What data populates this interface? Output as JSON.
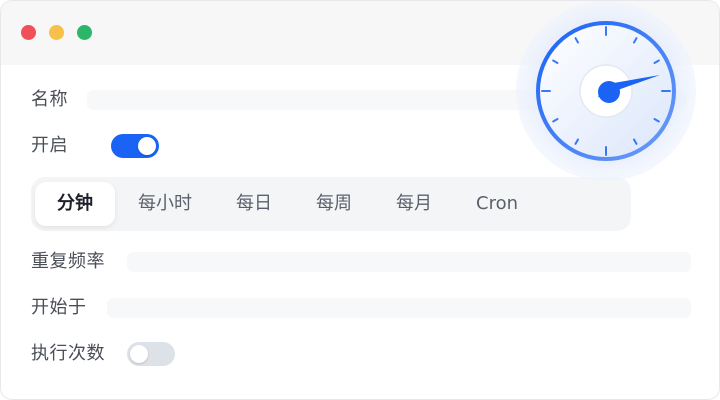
{
  "window": {
    "controls": [
      "close",
      "minimize",
      "maximize"
    ]
  },
  "form": {
    "name_label": "名称",
    "enable_label": "开启",
    "enable_on": true,
    "repeat_label": "重复频率",
    "start_label": "开始于",
    "exec_count_label": "执行次数",
    "exec_count_on": false
  },
  "tabs": {
    "items": [
      {
        "label": "分钟",
        "active": true
      },
      {
        "label": "每小时",
        "active": false
      },
      {
        "label": "每日",
        "active": false
      },
      {
        "label": "每周",
        "active": false
      },
      {
        "label": "每月",
        "active": false
      },
      {
        "label": "Cron",
        "active": false
      }
    ]
  },
  "gauge": {
    "icon": "speedometer-icon",
    "accent": "#1a63f5"
  },
  "colors": {
    "accent": "#1a63f5",
    "toggle_off": "#dde1e8"
  }
}
